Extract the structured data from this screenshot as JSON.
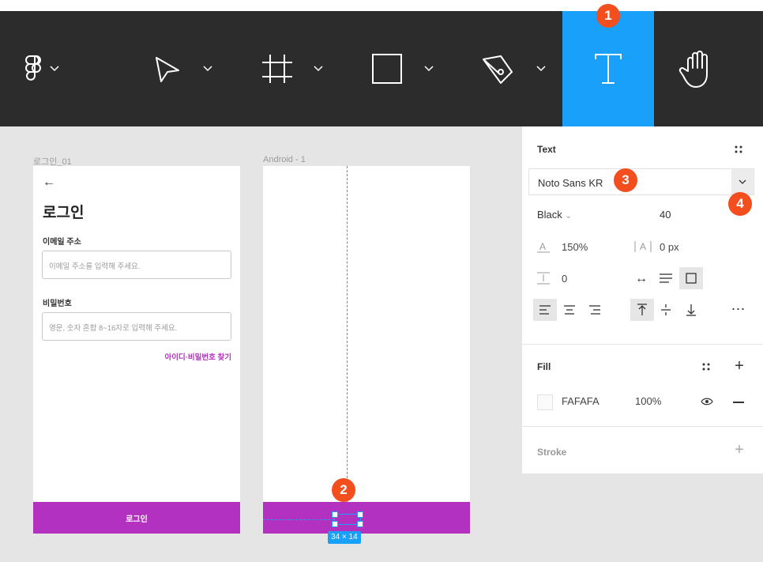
{
  "toolbar": {
    "tools": [
      "figma-menu",
      "move",
      "frame",
      "rectangle",
      "pen",
      "text",
      "hand"
    ],
    "active_tool": "text",
    "active_color": "#18a0fb"
  },
  "badges": [
    "1",
    "2",
    "3",
    "4"
  ],
  "canvas": {
    "frame1": {
      "label": "로그인_01",
      "back_arrow": "←",
      "title": "로그인",
      "email_label": "이메일 주소",
      "email_placeholder": "이메일 주소를 입력해 주세요.",
      "password_label": "비밀번호",
      "password_placeholder": "영문, 숫자 혼합 8~16자로 입력해 주세요.",
      "find_link": "아이디·비밀번호 찾기",
      "button_label": "로그인",
      "accent": "#b231bf"
    },
    "frame2": {
      "label": "Android - 1",
      "selection_size": "34 × 14"
    }
  },
  "panel": {
    "text_section": {
      "title": "Text",
      "font_family": "Noto Sans KR",
      "font_weight": "Black",
      "font_size": "40",
      "line_height": "150%",
      "letter_spacing": "0 px",
      "paragraph_spacing": "0"
    },
    "fill_section": {
      "title": "Fill",
      "color_hex": "FAFAFA",
      "opacity": "100%",
      "swatch": "#fafafa"
    },
    "stroke_section": {
      "title": "Stroke"
    }
  }
}
